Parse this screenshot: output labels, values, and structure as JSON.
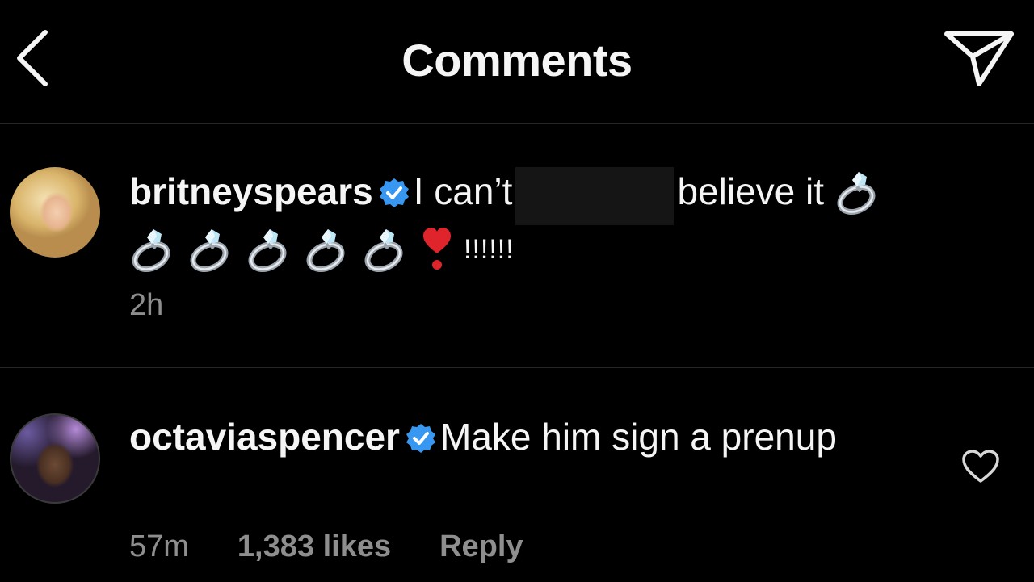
{
  "header": {
    "title": "Comments",
    "back_icon": "chevron-left-icon",
    "send_icon": "paper-plane-icon"
  },
  "comments": [
    {
      "username": "britneyspears",
      "verified": true,
      "text_before": "I can’t",
      "text_after": "believe it",
      "emojis": [
        "ring",
        "ring",
        "ring",
        "ring",
        "ring",
        "ring",
        "heavy-heart-exclamation"
      ],
      "exclamations": "!!!!!!",
      "time": "2h"
    },
    {
      "username": "octaviaspencer",
      "verified": true,
      "text": "Make him sign a prenup",
      "time": "57m",
      "likes": "1,383 likes",
      "reply": "Reply"
    }
  ],
  "colors": {
    "background": "#000000",
    "text": "#f5f5f5",
    "meta": "#8e8e8e",
    "verified": "#3897f0",
    "heart_emoji": "#e0242c"
  }
}
